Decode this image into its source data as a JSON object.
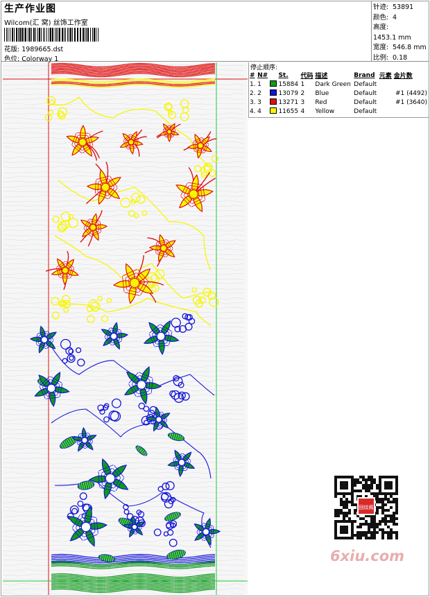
{
  "header": {
    "title": "生产作业图",
    "subtitle": "Wilcom(汇 窝) 丝饰工作室",
    "design_label": "花版:",
    "design_value": "1989665.dst",
    "colorway_label": "色位:",
    "colorway_value": "Colorway 1"
  },
  "stats": [
    {
      "label": "针迹:",
      "value": "53891"
    },
    {
      "label": "颜色:",
      "value": "4"
    },
    {
      "label": "高度:",
      "value": "1453.1 mm"
    },
    {
      "label": "宽度:",
      "value": "546.8 mm"
    },
    {
      "label": "比例:",
      "value": "0.18"
    }
  ],
  "stop_sequence": {
    "caption": "停止顺序:",
    "headers": [
      "#",
      "N#",
      "St.",
      "代码",
      "描述",
      "Brand",
      "元素",
      "金片数"
    ],
    "rows": [
      {
        "idx": "1.",
        "n": "1",
        "color": "#0f9a1c",
        "st": "15884",
        "code": "1",
        "desc": "Dark Green",
        "brand": "Default",
        "element": "",
        "sequins": ""
      },
      {
        "idx": "2.",
        "n": "2",
        "color": "#1414d8",
        "st": "13079",
        "code": "2",
        "desc": "Blue",
        "brand": "Default",
        "element": "",
        "sequins": "#1 (4492)"
      },
      {
        "idx": "3.",
        "n": "3",
        "color": "#e01010",
        "st": "13271",
        "code": "3",
        "desc": "Red",
        "brand": "Default",
        "element": "",
        "sequins": "#1 (3640)"
      },
      {
        "idx": "4.",
        "n": "4",
        "color": "#f6f600",
        "st": "11655",
        "code": "4",
        "desc": "Yellow",
        "brand": "Default",
        "element": "",
        "sequins": ""
      }
    ]
  },
  "watermark": "6xiu.com",
  "qr_seal": "回纹阁",
  "colors": {
    "green": "#0f9a1c",
    "blue": "#1414d8",
    "red": "#e01010",
    "yellow": "#f6f600",
    "guide_red": "#e01010",
    "guide_green": "#22c83a"
  }
}
